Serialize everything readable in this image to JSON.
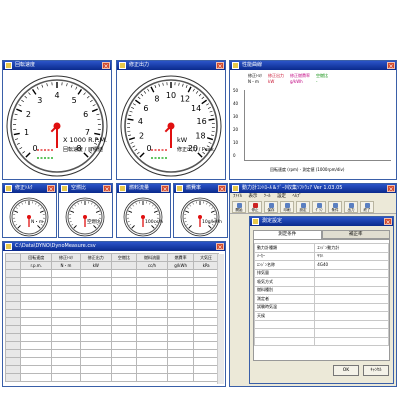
{
  "windows": {
    "rpm": {
      "title": "回転速度"
    },
    "power": {
      "title": "修正出力"
    },
    "perf": {
      "title": "性能曲線"
    },
    "g1": {
      "title": "修正ﾄﾙｸ"
    },
    "g2": {
      "title": "空燃比"
    },
    "g3": {
      "title": "燃料流量"
    },
    "g4": {
      "title": "燃費率"
    },
    "data": {
      "title": "C:\\Data\\DYNO\\DynoMeasure.csv"
    },
    "app": {
      "title": "動力計ｺﾝﾄﾛｰﾙ＆ﾃﾞｰﾀ収集ｿﾌﾄｳｪｱ Ver 1.03.05"
    },
    "cond": {
      "title": "測定設定"
    }
  },
  "gauges": {
    "rpm": {
      "ticks": [
        "0",
        "1",
        "2",
        "3",
        "4",
        "5",
        "6",
        "7",
        "8"
      ],
      "value": 0,
      "unit": "X 1000 R.P.M.",
      "sub": "回転速度 / 目標値"
    },
    "power": {
      "ticks": [
        "0",
        "2",
        "4",
        "6",
        "8",
        "10",
        "12",
        "14",
        "16",
        "18",
        "20"
      ],
      "value": 0,
      "unit": "kW",
      "sub": "修正出力 / Peak"
    },
    "g1": {
      "label": "N・m",
      "value": 0
    },
    "g2": {
      "label": "空燃比",
      "value": 0
    },
    "g3": {
      "label": "100cc/h",
      "value": 0
    },
    "g4": {
      "label": "10g/kWh",
      "value": 0
    }
  },
  "perf": {
    "legend": [
      "修正ﾄﾙｸ",
      "修正出力",
      "修正燃費率",
      "空燃比"
    ],
    "legend_units": [
      "N・m",
      "kW",
      "g/kWh",
      "-"
    ],
    "legend_colors": [
      "#000000",
      "#c8102e",
      "#c00080",
      "#008800"
    ],
    "yticks": [
      "50",
      "40",
      "30",
      "20",
      "10",
      "0"
    ],
    "xlabel": "回転速度 (rpm) - 測定値 (1000rpm/div)"
  },
  "data_table": {
    "headers": [
      "",
      "回転速度",
      "修正ﾄﾙｸ",
      "修正出力",
      "空燃比",
      "燃料流量",
      "燃費率",
      "大気圧"
    ],
    "units": [
      "",
      "r.p.m.",
      "N・m",
      "kW",
      "",
      "cc/h",
      "g/kWh",
      "kPa"
    ]
  },
  "app": {
    "menu": [
      "ﾌｧｲﾙ",
      "表示",
      "ﾂｰﾙ",
      "設定",
      "ﾍﾙﾌﾟ"
    ],
    "tools": [
      "開始",
      "停止",
      "保存",
      "印刷",
      "設定",
      "ｸﾞﾗﾌ",
      "条件",
      "出力",
      "終了"
    ]
  },
  "conditions": {
    "tab_left": "測定条件",
    "tab_right": "補正率",
    "rows": [
      {
        "label": "動力計種類",
        "value": "ｴﾝｼﾞﾝ動力計"
      },
      {
        "label": "ﾒｰｶｰ",
        "value": "ﾔﾏﾊ"
      },
      {
        "label": "ｴﾝｼﾞﾝ名称",
        "value": "4G40"
      },
      {
        "label": "排気量",
        "value": ""
      },
      {
        "label": "吸気方式",
        "value": ""
      },
      {
        "label": "燃料種別",
        "value": ""
      },
      {
        "label": "測定者",
        "value": ""
      },
      {
        "label": "試験時気温",
        "value": ""
      },
      {
        "label": "天候",
        "value": ""
      },
      {
        "label": "",
        "value": ""
      },
      {
        "label": "",
        "value": ""
      },
      {
        "label": "",
        "value": ""
      }
    ],
    "ok": "OK",
    "cancel": "ｷｬﾝｾﾙ"
  },
  "colors": {
    "titlebar": "#0a2a8c",
    "needle": "#e01010",
    "face": "#ffffff"
  }
}
